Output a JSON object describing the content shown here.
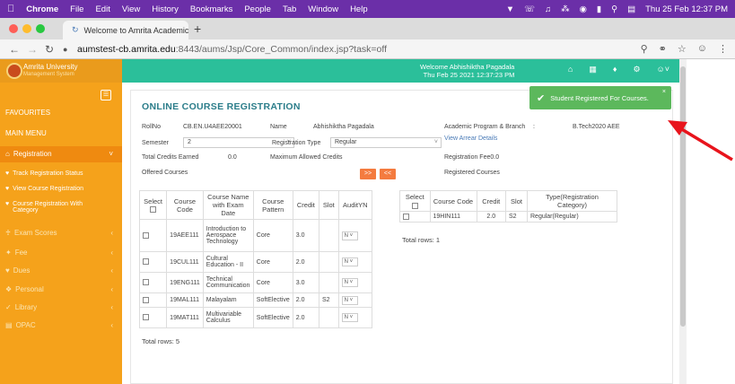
{
  "menubar": {
    "app": "Chrome",
    "items": [
      "File",
      "Edit",
      "View",
      "History",
      "Bookmarks",
      "People",
      "Tab",
      "Window",
      "Help"
    ],
    "clock": "Thu 25 Feb  12:37 PM"
  },
  "tab": {
    "title": "Welcome to Amrita Academic"
  },
  "address": {
    "host": "aumstest-cb.amrita.edu",
    "path": ":8443/aums/Jsp/Core_Common/index.jsp?task=off"
  },
  "header": {
    "logo_title": "Amrita University",
    "logo_sub": "Management System",
    "welcome_line1": "Welcome Abhishiktha Pagadala",
    "welcome_line2": "Thu Feb 25 2021 12:37:23 PM"
  },
  "sidebar": {
    "favourites": "FAVOURITES",
    "main_menu": "MAIN MENU",
    "registration": "Registration",
    "sub": [
      "Track Registration Status",
      "View Course Registration",
      "Course Registration With Category"
    ],
    "items": [
      "Exam Scores",
      "Fee",
      "Dues",
      "Personal",
      "Library",
      "OPAC"
    ]
  },
  "form": {
    "title": "ONLINE COURSE REGISTRATION",
    "rollno_label": "RollNo",
    "rollno": "CB.EN.U4AEE20001",
    "name_label": "Name",
    "name": "Abhishiktha Pagadala",
    "program_label": "Academic Program & Branch",
    "program_sep": ":",
    "program": "B.Tech2020 AEE",
    "semester_label": "Semester",
    "semester": "2",
    "regtype_label": "Registration Type",
    "regtype": "Regular",
    "arrear_link": "View Arrear Details",
    "credits_earned_label": "Total Credits Earned",
    "credits_earned": "0.0",
    "max_credits_label": "Maximum Allowed Credits",
    "reg_fee": "Registration Fee0.0",
    "offered_label": "Offered Courses",
    "registered_label": "Registered Courses",
    "btn_add": ">>",
    "btn_remove": "<<"
  },
  "offered": {
    "headers": [
      "Select",
      "Course Code",
      "Course Name with Exam Date",
      "Course Pattern",
      "Credit",
      "Slot",
      "AuditYN"
    ],
    "rows": [
      {
        "code": "19AEE111",
        "name": "Introduction to Aerospace Technology",
        "pattern": "Core",
        "credit": "3.0",
        "slot": "",
        "audit": "N"
      },
      {
        "code": "19CUL111",
        "name": "Cultural Education - II",
        "pattern": "Core",
        "credit": "2.0",
        "slot": "",
        "audit": "N"
      },
      {
        "code": "19ENG111",
        "name": "Technical Communication",
        "pattern": "Core",
        "credit": "3.0",
        "slot": "",
        "audit": "N"
      },
      {
        "code": "19MAL111",
        "name": "Malayalam",
        "pattern": "SoftElective",
        "credit": "2.0",
        "slot": "S2",
        "audit": "N"
      },
      {
        "code": "19MAT111",
        "name": "Multivariable Calculus",
        "pattern": "SoftElective",
        "credit": "2.0",
        "slot": "",
        "audit": "N"
      }
    ],
    "total": "Total rows: 5"
  },
  "registered": {
    "headers": [
      "Select",
      "Course Code",
      "Credit",
      "Slot",
      "Type(Registration Category)"
    ],
    "rows": [
      {
        "code": "19HIN111",
        "credit": "2.0",
        "slot": "S2",
        "type": "Regular(Regular)"
      }
    ],
    "total": "Total rows: 1"
  },
  "toast": {
    "message": "Student Registered For Courses.",
    "close": "×",
    "color": "#5cb85c"
  },
  "colors": {
    "teal": "#2bbf9a",
    "orange": "#f5a21b",
    "arrow": "#e8141c"
  }
}
